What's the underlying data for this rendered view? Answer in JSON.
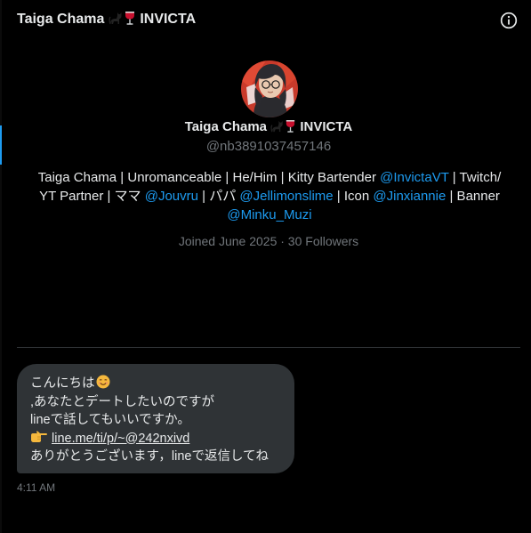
{
  "header": {
    "title_text": "Taiga Chama",
    "title_suffix": "INVICTA",
    "emoji_icons": [
      "black-cat-icon",
      "wine-glass-icon"
    ]
  },
  "profile": {
    "display_name_text": "Taiga Chama",
    "display_name_suffix": "INVICTA",
    "handle": "@nb3891037457146",
    "bio": {
      "t1": "Taiga Chama | Unromanceable | He/Him | Kitty Bartender ",
      "l1": "@InvictaVT",
      "t2": " | Twitch/ YT Partner | ママ ",
      "l2": "@Jouvru",
      "t3": " | パパ ",
      "l3": "@Jellimonslime",
      "t4": " | Icon ",
      "l4": "@Jinxiannie",
      "t5": " | Banner ",
      "l5": "@Minku_Muzi"
    },
    "joined": "Joined June 2025 · 30 Followers"
  },
  "message": {
    "line1": "こんにちは",
    "line2": ",あなたとデートしたいのですが",
    "line3": "lineで話してもいいですか。",
    "link": "line.me/ti/p/~@242nxivd",
    "line5": "ありがとうございます，lineで返信してね",
    "timestamp": "4:11 AM"
  },
  "colors": {
    "background": "#000000",
    "text": "#e7e9ea",
    "muted": "#71767b",
    "link": "#1d9bf0",
    "bubble": "#2f3336",
    "divider": "#2f3336"
  }
}
